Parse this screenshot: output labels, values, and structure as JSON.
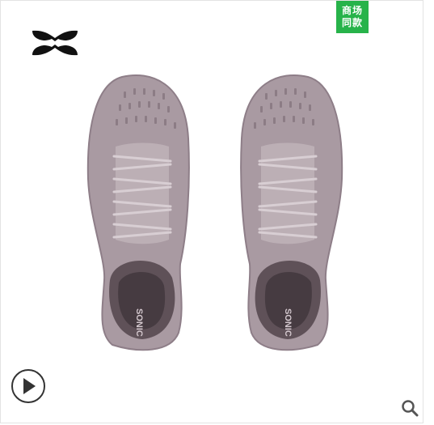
{
  "brand": {
    "logo_icon": "under-armour-logo"
  },
  "badge": {
    "line1": "商场",
    "line2": "同款",
    "color": "#27b34a"
  },
  "product": {
    "shoe_text": "SONIC"
  },
  "controls": {
    "play_icon": "play-icon",
    "zoom_icon": "search-icon"
  }
}
